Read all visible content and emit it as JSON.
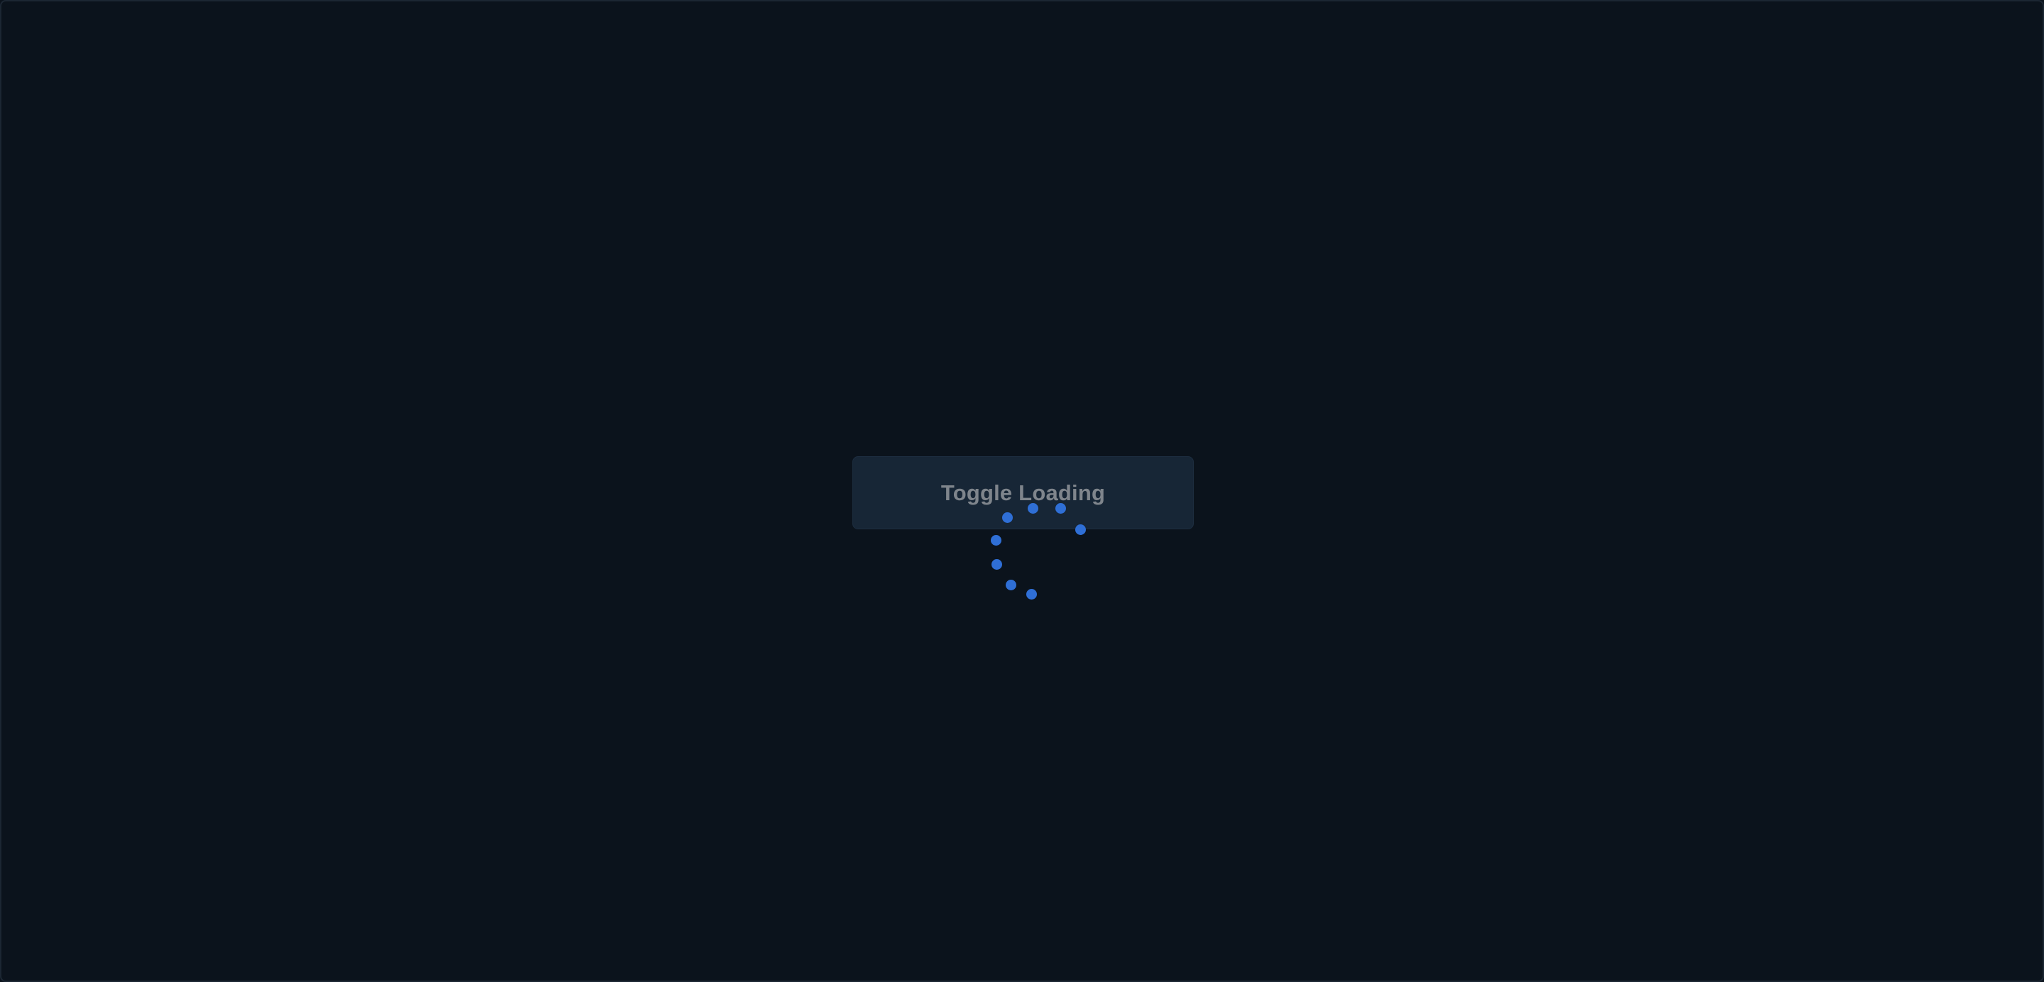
{
  "button": {
    "label": "Toggle Loading"
  },
  "spinner": {
    "icon": "loading-spinner-icon",
    "dot_color": "#2f6fd6"
  },
  "colors": {
    "background": "#0b131c",
    "button_background": "#172636",
    "button_text": "#7f858c"
  }
}
